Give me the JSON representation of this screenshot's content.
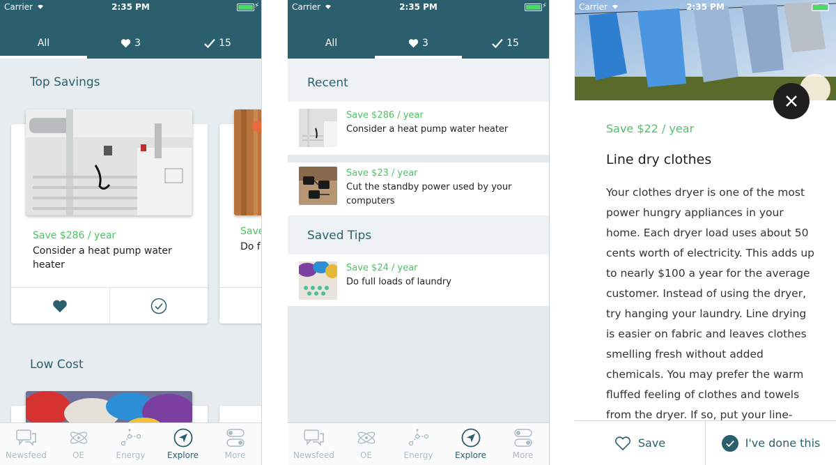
{
  "status": {
    "carrier": "Carrier",
    "time": "2:35 PM",
    "bolt": "⚡"
  },
  "tabs": {
    "all": "All",
    "favorites_count": "3",
    "done_count": "15"
  },
  "nav": [
    {
      "label": "Newsfeed",
      "icon": "chat-bubbles-icon"
    },
    {
      "label": "OE",
      "icon": "atom-icon"
    },
    {
      "label": "Energy",
      "icon": "network-icon"
    },
    {
      "label": "Explore",
      "icon": "compass-icon"
    },
    {
      "label": "More",
      "icon": "toggles-icon"
    }
  ],
  "screen1": {
    "section_top": "Top Savings",
    "section_low": "Low Cost",
    "card1": {
      "save": "Save $286 / year",
      "title": "Consider a heat pump water heater"
    },
    "card2": {
      "save": "Save",
      "title": "Do f"
    }
  },
  "screen2": {
    "recent_title": "Recent",
    "saved_title": "Saved Tips",
    "recent": [
      {
        "save": "Save $286 / year",
        "desc": "Consider a heat pump water heater"
      },
      {
        "save": "Save $23 / year",
        "desc": "Cut the standby power used by your computers"
      }
    ],
    "saved": [
      {
        "save": "Save $24 / year",
        "desc": "Do full loads of laundry"
      }
    ]
  },
  "screen3": {
    "save": "Save $22 / year",
    "title": "Line dry clothes",
    "body": "Your clothes dryer is one of the most power hungry appliances in your home. Each dryer load uses about 50 cents worth of electricity. This adds up to nearly $100 a year for the average customer. Instead of using the dryer, try hanging your laundry. Line drying is easier on fabric and leaves clothes smelling fresh without added chemicals. You may prefer the warm fluffed feeling of clothes and towels from the dryer. If so, put your line-dried",
    "save_button": "Save",
    "done_button": "I've done this"
  },
  "colors": {
    "header": "#2c5f6e",
    "green": "#4cc366",
    "nav_inactive": "#a9bcc4"
  }
}
